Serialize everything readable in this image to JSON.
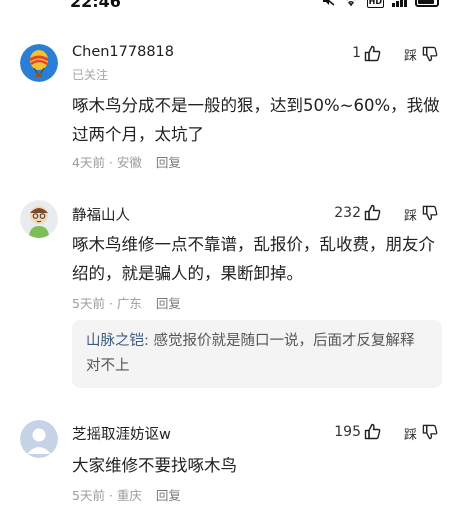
{
  "status_bar": {
    "time": "22:46",
    "icons": [
      "mute-icon",
      "wifi-icon",
      "hd-icon",
      "signal-icon",
      "battery-icon"
    ],
    "hd_label": "HD"
  },
  "comments": [
    {
      "author": "Chen1778818",
      "tag": "已关注",
      "likes": "1",
      "dislike_label": "踩",
      "text": "啄木鸟分成不是一般的狠，达到50%~60%，我做过两个月，太坑了",
      "time": "4天前",
      "location": "安徽",
      "reply_label": "回复"
    },
    {
      "author": "静福山人",
      "likes": "232",
      "dislike_label": "踩",
      "text": "啄木鸟维修一点不靠谱，乱报价，乱收费，朋友介绍的，就是骗人的，果断卸掉。",
      "time": "5天前",
      "location": "广东",
      "reply_label": "回复",
      "sub_reply": {
        "author": "山脉之铠",
        "text": "感觉报价就是随口一说，后面才反复解释对不上"
      }
    },
    {
      "author": "芝摇取涯妨讴w",
      "likes": "195",
      "dislike_label": "踩",
      "text": "大家维修不要找啄木鸟",
      "time": "5天前",
      "location": "重庆",
      "reply_label": "回复"
    }
  ],
  "colors": {
    "accent_link": "#3e5b7f",
    "meta_gray": "#9c9c9c",
    "reply_bg": "#f4f4f4"
  }
}
